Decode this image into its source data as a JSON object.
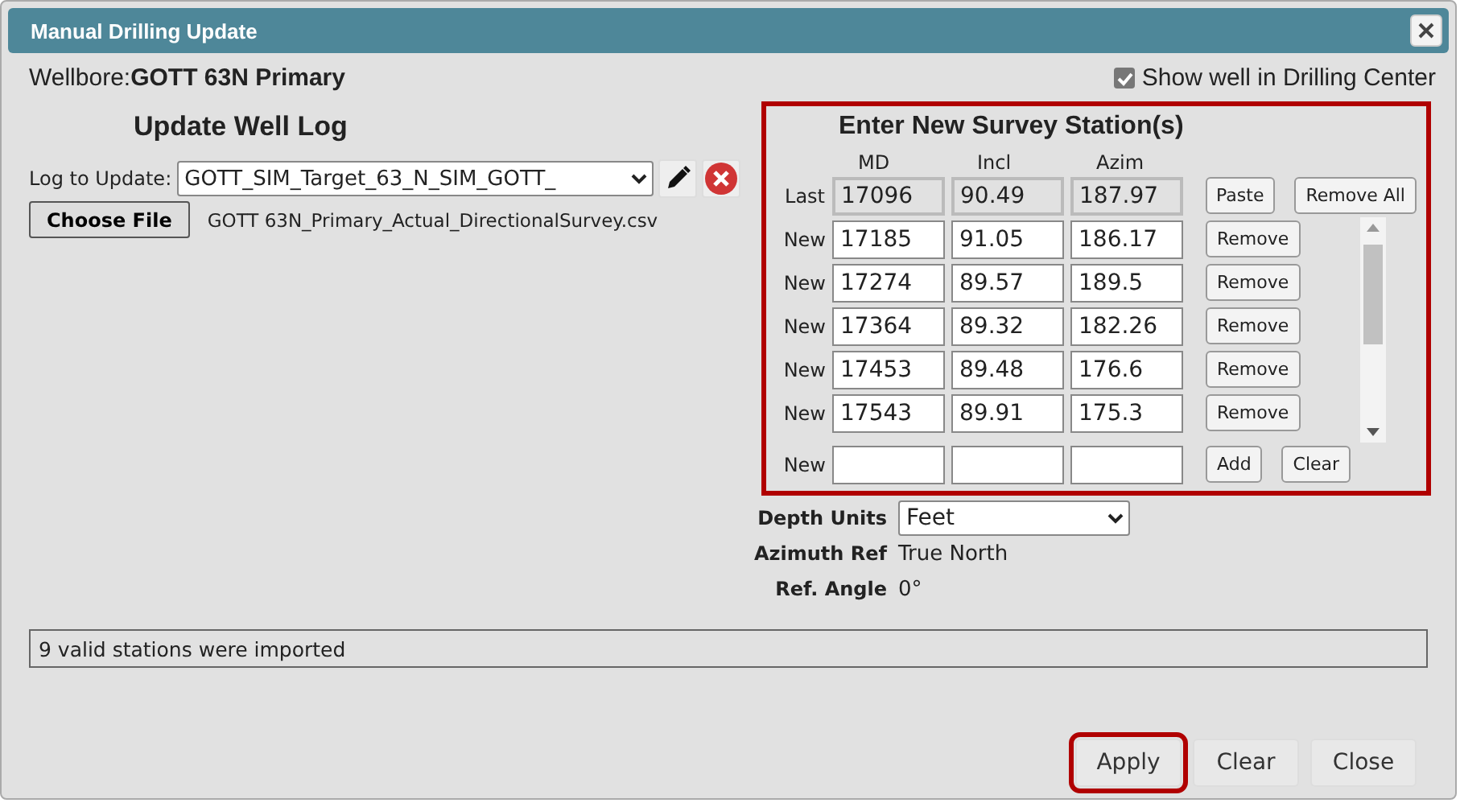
{
  "window": {
    "title": "Manual Drilling Update"
  },
  "wellbore": {
    "label": "Wellbore:",
    "name": "GOTT 63N Primary"
  },
  "show_in_center": {
    "label": "Show well in Drilling Center",
    "checked": true
  },
  "well_log": {
    "title": "Update Well Log",
    "log_label": "Log to Update:",
    "log_value": "GOTT_SIM_Target_63_N_SIM_GOTT_",
    "choose_file": "Choose File",
    "file_name": "GOTT 63N_Primary_Actual_DirectionalSurvey.csv"
  },
  "survey": {
    "title": "Enter New Survey Station(s)",
    "highlighted": true,
    "columns": [
      "MD",
      "Incl",
      "Azim"
    ],
    "last": {
      "label": "Last",
      "values": [
        "17096",
        "90.49",
        "187.97"
      ],
      "paste": "Paste",
      "remove_all": "Remove All"
    },
    "rows": [
      {
        "label": "New",
        "values": [
          "17185",
          "91.05",
          "186.17"
        ],
        "button": "Remove"
      },
      {
        "label": "New",
        "values": [
          "17274",
          "89.57",
          "189.5"
        ],
        "button": "Remove"
      },
      {
        "label": "New",
        "values": [
          "17364",
          "89.32",
          "182.26"
        ],
        "button": "Remove"
      },
      {
        "label": "New",
        "values": [
          "17453",
          "89.48",
          "176.6"
        ],
        "button": "Remove"
      },
      {
        "label": "New",
        "values": [
          "17543",
          "89.91",
          "175.3"
        ],
        "button": "Remove"
      }
    ],
    "new_row": {
      "label": "New",
      "add": "Add",
      "clear": "Clear"
    }
  },
  "settings": [
    {
      "label": "Depth Units",
      "kind": "select",
      "value": "Feet"
    },
    {
      "label": "Azimuth Ref",
      "kind": "text",
      "value": "True North"
    },
    {
      "label": "Ref. Angle",
      "kind": "text",
      "value": "0°"
    }
  ],
  "status": "9 valid stations were imported",
  "buttons": [
    {
      "label": "Apply",
      "highlighted": true
    },
    {
      "label": "Clear",
      "highlighted": false
    },
    {
      "label": "Close",
      "highlighted": false
    }
  ]
}
